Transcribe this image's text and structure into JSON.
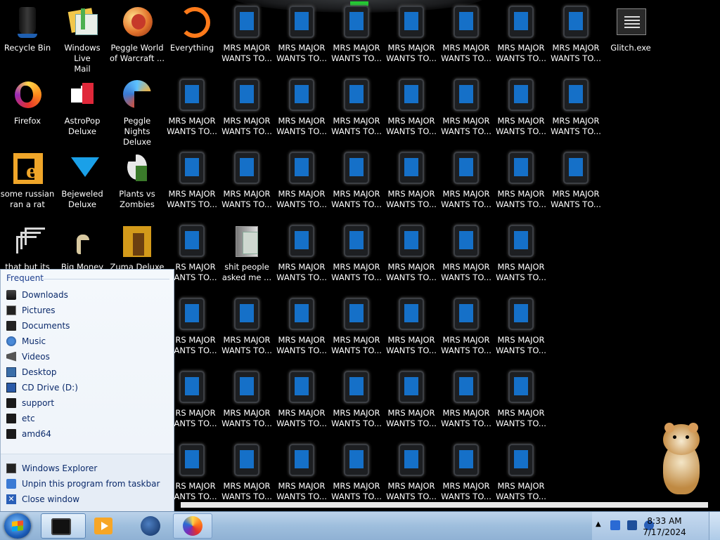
{
  "desktop": {
    "icons": [
      {
        "id": "recycle-bin",
        "label": "Recycle Bin"
      },
      {
        "id": "windows-live-mail",
        "label": "Windows Live\nMail"
      },
      {
        "id": "peggle-world",
        "label": "Peggle World\nof Warcraft ..."
      },
      {
        "id": "everything",
        "label": "Everything"
      },
      {
        "id": "glitch",
        "label": "Glitch.exe"
      },
      {
        "id": "firefox",
        "label": "Firefox"
      },
      {
        "id": "astropop",
        "label": "AstroPop\nDeluxe"
      },
      {
        "id": "peggle-nights",
        "label": "Peggle Nights\nDeluxe"
      },
      {
        "id": "some-russian",
        "label": "some russian\nran a rat"
      },
      {
        "id": "bejeweled",
        "label": "Bejeweled\nDeluxe"
      },
      {
        "id": "pvz",
        "label": "Plants vs\nZombies"
      },
      {
        "id": "that-but-its-c",
        "label": "that but its c#"
      },
      {
        "id": "big-money",
        "label": "Big Money"
      },
      {
        "id": "zuma",
        "label": "Zuma Deluxe"
      },
      {
        "id": "shit-people",
        "label": "shit people\nasked me ..."
      }
    ],
    "mrs_major_label": "MRS MAJOR\nWANTS TO...",
    "mrs_major_label_cut": "RS MAJOR\nANTS TO..."
  },
  "jumplist": {
    "header": "Frequent",
    "items": [
      {
        "label": "Downloads",
        "icon": "drive-icon"
      },
      {
        "label": "Pictures",
        "icon": "screen-icon"
      },
      {
        "label": "Documents",
        "icon": "documents-icon"
      },
      {
        "label": "Music",
        "icon": "music-icon"
      },
      {
        "label": "Videos",
        "icon": "videos-icon"
      },
      {
        "label": "Desktop",
        "icon": "desktop-icon"
      },
      {
        "label": "CD Drive (D:)",
        "icon": "cd-drive-icon"
      },
      {
        "label": "support",
        "icon": "folder-icon"
      },
      {
        "label": "etc",
        "icon": "folder-icon"
      },
      {
        "label": "amd64",
        "icon": "folder-icon"
      }
    ],
    "tasks": [
      {
        "label": "Windows Explorer",
        "icon": "explorer-icon"
      },
      {
        "label": "Unpin this program from taskbar",
        "icon": "unpin-icon"
      },
      {
        "label": "Close window",
        "icon": "close-icon"
      }
    ]
  },
  "taskbar": {
    "clock_time": "8:33 AM",
    "clock_date": "7/17/2024",
    "pinned": [
      "mrs-major-app-icon",
      "media-player-icon",
      "internet-explorer-icon",
      "firefox-icon"
    ]
  },
  "colors": {
    "accent": "#1e3f8f",
    "taskbar": "#9ebedd",
    "mrs_screen": "#1570c8"
  }
}
